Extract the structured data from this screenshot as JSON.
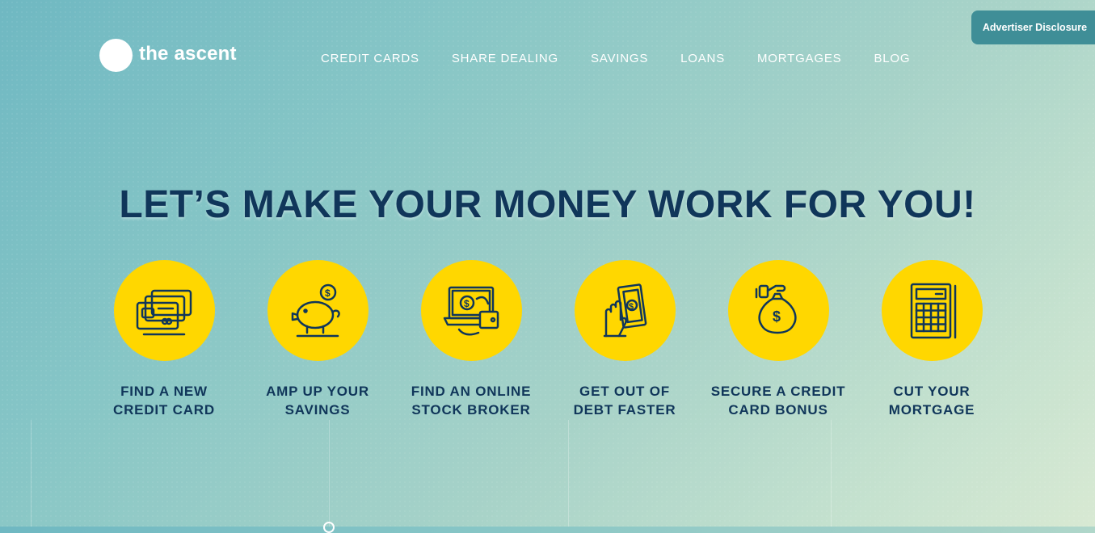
{
  "header": {
    "logo_text": "the ascent",
    "nav": [
      {
        "label": "CREDIT CARDS"
      },
      {
        "label": "SHARE DEALING"
      },
      {
        "label": "SAVINGS"
      },
      {
        "label": "LOANS"
      },
      {
        "label": "MORTGAGES"
      },
      {
        "label": "BLOG"
      }
    ],
    "disclosure_label": "Advertiser Disclosure"
  },
  "hero": {
    "headline": "LET’S MAKE YOUR MONEY WORK FOR YOU!",
    "features": [
      {
        "label": "FIND A NEW\nCREDIT CARD",
        "icon": "credit-cards-icon"
      },
      {
        "label": "AMP UP YOUR\nSAVINGS",
        "icon": "piggy-bank-icon"
      },
      {
        "label": "FIND AN ONLINE\nSTOCK BROKER",
        "icon": "laptop-trading-icon"
      },
      {
        "label": "GET OUT OF\nDEBT FASTER",
        "icon": "hand-cash-icon"
      },
      {
        "label": "SECURE A CREDIT\nCARD BONUS",
        "icon": "money-bag-icon"
      },
      {
        "label": "CUT YOUR\nMORTGAGE",
        "icon": "calculator-icon"
      }
    ]
  },
  "colors": {
    "accent_yellow": "#ffd700",
    "navy": "#10365a",
    "disclosure_bg": "#3f8e97"
  }
}
